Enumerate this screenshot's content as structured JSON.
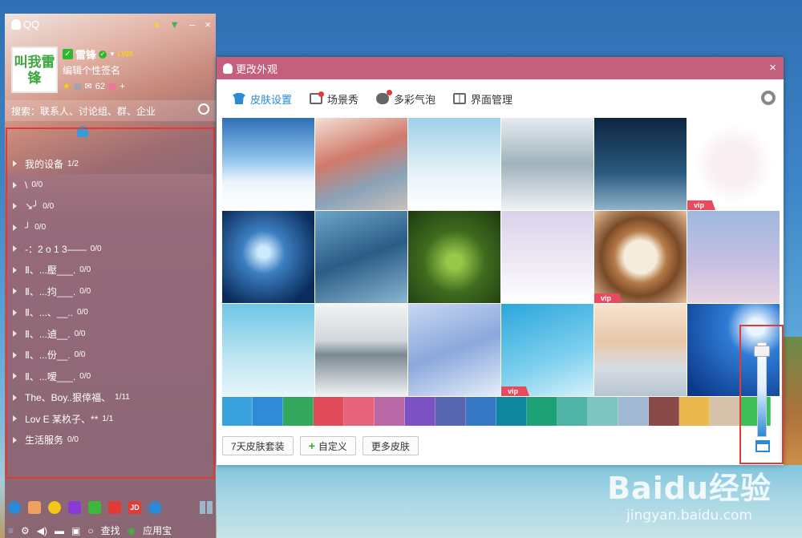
{
  "qq": {
    "title": "QQ",
    "nickname": "雷锋",
    "level": "LV28",
    "signature": "编辑个性签名",
    "avatar_text": "叫我雷锋",
    "msg_count": "62",
    "search_placeholder": "搜索：联系人、讨论组、群、企业",
    "groups": [
      {
        "name": "我的设备",
        "count": "1/2"
      },
      {
        "name": "\\",
        "count": "0/0"
      },
      {
        "name": "↘╯",
        "count": "0/0"
      },
      {
        "name": "╯",
        "count": "0/0"
      },
      {
        "name": "-：2 o 1 3——",
        "count": "0/0"
      },
      {
        "name": "Ⅱ、...壓___.",
        "count": "0/0"
      },
      {
        "name": "Ⅱ、...抣___.",
        "count": "0/0"
      },
      {
        "name": "Ⅱ、...、__..",
        "count": "0/0"
      },
      {
        "name": "Ⅱ、...遉__.",
        "count": "0/0"
      },
      {
        "name": "Ⅱ、...份__.",
        "count": "0/0"
      },
      {
        "name": "Ⅱ、...嗳___.",
        "count": "0/0"
      },
      {
        "name": "The、Boy..狠倖福、",
        "count": "1/11"
      },
      {
        "name": "Lov E 某杦子、**",
        "count": "1/1"
      },
      {
        "name": "生活服务",
        "count": "0/0"
      }
    ],
    "bottom": {
      "find": "查找",
      "appstore": "应用宝"
    }
  },
  "dialog": {
    "title": "更改外观",
    "close": "×",
    "tabs": [
      {
        "label": "皮肤设置",
        "active": true
      },
      {
        "label": "场景秀",
        "active": false
      },
      {
        "label": "多彩气泡",
        "active": false
      },
      {
        "label": "界面管理",
        "active": false
      }
    ],
    "vip_label": "vip",
    "thumbnails": [
      {
        "name": "sky-clouds",
        "vip": false,
        "bg": "linear-gradient(180deg,#2e6fb8,#8fc3ec 45%,#eef6fb 70%,#ffffff)"
      },
      {
        "name": "street-houses",
        "vip": false,
        "bg": "linear-gradient(160deg,#f3e0d6,#d07a6a 40%,#8aa3b8 70%,#c9c1bc)"
      },
      {
        "name": "snowman-forest",
        "vip": false,
        "bg": "linear-gradient(180deg,#9fd0ea,#e6f2f8 60%,#ffffff)"
      },
      {
        "name": "snowy-trees",
        "vip": false,
        "bg": "linear-gradient(180deg,#e6ecf0,#9fb2bd 50%,#eef2f4)"
      },
      {
        "name": "night-lamp-umbrella",
        "vip": false,
        "bg": "linear-gradient(180deg,#0d2540,#2b5a80 60%,#8fb3c8)"
      },
      {
        "name": "snowflake-pattern",
        "vip": true,
        "bg": "radial-gradient(circle,#f9eef2 30%,#ffffff 60%)"
      },
      {
        "name": "snowflake-macro",
        "vip": false,
        "bg": "radial-gradient(circle at 45% 45%,#cfe9ff 8%,#3c7fc0 30%,#0a2c5c 80%)"
      },
      {
        "name": "merry-christmas",
        "vip": false,
        "bg": "linear-gradient(160deg,#6fa6c9,#2a5c86 50%,#8ab6d0)"
      },
      {
        "name": "pine-branch",
        "vip": false,
        "bg": "radial-gradient(circle at 50% 55%,#9ac94a 10%,#3f6b1e 45%,#1d3a10)"
      },
      {
        "name": "couple-walking",
        "vip": false,
        "bg": "linear-gradient(180deg,#d9d2ea,#eee9f5 55%,#ffffff)"
      },
      {
        "name": "latte-art",
        "vip": true,
        "bg": "radial-gradient(circle,#f4ecdc 25%,#b77a48 40%,#7a4a28 60%,#e8c09a)"
      },
      {
        "name": "misty-trees",
        "vip": false,
        "bg": "linear-gradient(180deg,#9fb8de,#c9c0e2 60%,#e8d4e2)"
      },
      {
        "name": "blue-branch",
        "vip": false,
        "bg": "linear-gradient(180deg,#6fc6e6,#bfe6f2 60%,#e8f6fa)"
      },
      {
        "name": "winter-lake",
        "vip": false,
        "bg": "linear-gradient(180deg,#f2f4f6,#d0d6da 40%,#7a8a94 55%,#f0f2f4)"
      },
      {
        "name": "bird-berries",
        "vip": false,
        "bg": "linear-gradient(160deg,#c8d8f2,#8aa8dc 50%,#e6eefa)"
      },
      {
        "name": "white-feather",
        "vip": true,
        "bg": "linear-gradient(160deg,#2aa6dc,#7ed0ee 60%,#d6f1fa)"
      },
      {
        "name": "wooden-bridge",
        "vip": false,
        "bg": "linear-gradient(180deg,#f6e3cf,#e9c8a8 40%,#d6dce4 70%,#b7c4d2)"
      },
      {
        "name": "moon-reindeer",
        "vip": false,
        "bg": "radial-gradient(circle at 75% 25%,#eaf6ff 8%,#2f7cd6 30%,#0c3a8a 90%)"
      }
    ],
    "swatches": [
      "#3aa3dd",
      "#2f8bd8",
      "#33a85c",
      "#e04b5a",
      "#e8637e",
      "#b868a4",
      "#7a52c4",
      "#5866b0",
      "#3778c4",
      "#10879e",
      "#1fa176",
      "#4fb3a6",
      "#7ec4c0",
      "#a0b8d4",
      "#8a4a48",
      "#eab94e",
      "#d6c2aa",
      "#3fbf5a"
    ],
    "buttons": {
      "seven_day": "7天皮肤套装",
      "custom": "自定义",
      "more": "更多皮肤"
    }
  },
  "watermark": {
    "main": "Baidu经验",
    "sub": "jingyan.baidu.com"
  }
}
